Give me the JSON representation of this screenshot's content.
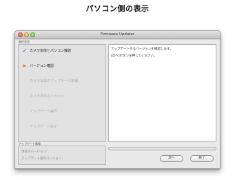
{
  "heading": "パソコン側の表示",
  "window": {
    "title": "Firmware Updater"
  },
  "steps_section_label": "進捗状況",
  "steps": [
    {
      "label": "カメラ本体とパソコン接続",
      "status": "done"
    },
    {
      "label": "バージョン確認",
      "status": "current"
    },
    {
      "label": "カメラ本体のアップデート準備",
      "status": "pending"
    },
    {
      "label": "カメラ本体のリセット",
      "status": "pending"
    },
    {
      "label": "アップデート実行",
      "status": "pending"
    },
    {
      "label": "アップデート完了",
      "status": "pending"
    }
  ],
  "messages": [
    "アップデートするバージョンを確認します。",
    "[次へ]ボタンを押してください。"
  ],
  "update_info": {
    "label": "アップデート情報",
    "current_version_label": "現在のバージョン:",
    "after_version_label": "アップデート後のバージョン:"
  },
  "buttons": {
    "next": "次へ",
    "finish": "終了"
  },
  "progress": 0,
  "colors": {
    "check": "#2a5fbf",
    "arrow": "#e07a1a"
  }
}
